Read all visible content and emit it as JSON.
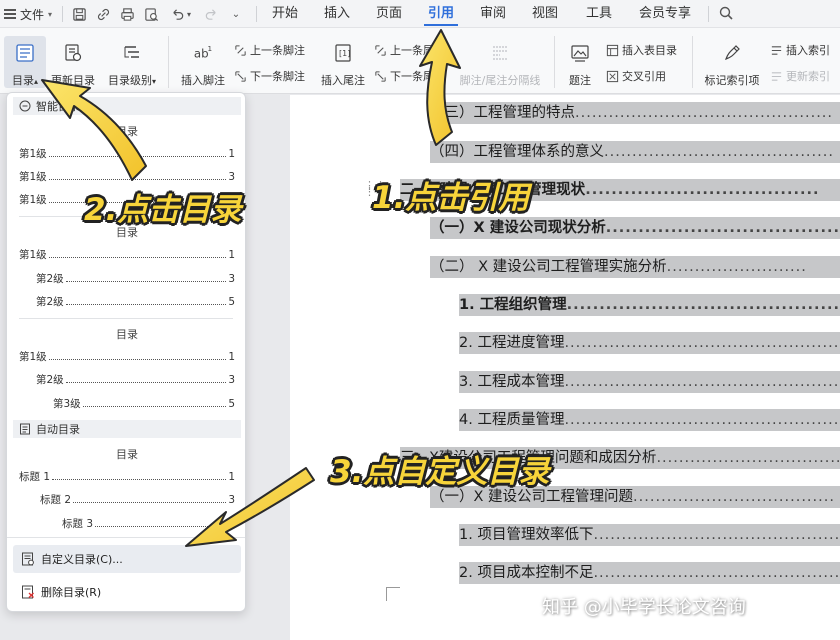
{
  "menubar": {
    "file_label": "文件",
    "tabs": [
      "开始",
      "插入",
      "页面",
      "引用",
      "审阅",
      "视图",
      "工具",
      "会员专享"
    ],
    "active_tab": "引用"
  },
  "ribbon": {
    "toc_label": "目录",
    "update_toc_label": "更新目录",
    "toc_level_label": "目录级别",
    "insert_footnote_label": "插入脚注",
    "prev_footnote_label": "上一条脚注",
    "next_footnote_label": "下一条脚注",
    "insert_endnote_label": "插入尾注",
    "prev_endnote_label": "上一条尾注",
    "next_endnote_label": "下一条尾注",
    "footnote_separator_label": "脚注/尾注分隔线",
    "caption_label": "题注",
    "insert_table_toc_label": "插入表目录",
    "cross_ref_label": "交叉引用",
    "mark_index_label": "标记索引项",
    "insert_index_label": "插入索引",
    "update_index_label": "更新索引"
  },
  "dropdown": {
    "smart_section": "智能目录",
    "auto_section": "自动目录",
    "toc_title": "目录",
    "level1": "第1级",
    "level2": "第2级",
    "level3": "第3级",
    "heading1": "标题 1",
    "heading2": "标题 2",
    "heading3": "标题 3",
    "page_1": "1",
    "page_3": "3",
    "page_5": "5",
    "custom_toc": "自定义目录(C)...",
    "delete_toc": "删除目录(R)"
  },
  "document": {
    "lines": [
      {
        "text": "（三）工程管理的特点",
        "dots": "..............................................",
        "bold": false
      },
      {
        "text": "（四）工程管理体系的意义",
        "dots": ".........................................",
        "bold": false
      },
      {
        "text": "二、X建设公司工程管理现状",
        "dots": "....................................",
        "bold": true
      },
      {
        "text": "（一）X 建设公司现状分析",
        "dots": "..........................................",
        "bold": true
      },
      {
        "text": "（二） X 建设公司工程管理实施分析",
        "dots": ".........................",
        "bold": false
      },
      {
        "text": "1. 工程组织管理",
        "dots": "..................................................",
        "bold": true
      },
      {
        "text": "2. 工程进度管理",
        "dots": "..................................................",
        "bold": false
      },
      {
        "text": "3. 工程成本管理",
        "dots": "..................................................",
        "bold": false
      },
      {
        "text": "4. 工程质量管理",
        "dots": "..................................................",
        "bold": false
      },
      {
        "text": "三、X建设公司工程管理问题和成因分析",
        "dots": ".................................",
        "bold": false
      },
      {
        "text": "（一）X 建设公司工程管理问题",
        "dots": "....................................",
        "bold": false
      },
      {
        "text": "1. 项目管理效率低下",
        "dots": ".............................................",
        "bold": false
      },
      {
        "text": "2. 项目成本控制不足",
        "dots": ".............................................",
        "bold": false
      }
    ]
  },
  "annotations": {
    "step1": "1.点击引用",
    "step2": "2.点击目录",
    "step3": "3.点自定义目录",
    "watermark": "知乎 @小毕学长论文咨询"
  },
  "colors": {
    "accent": "#2f6fdb",
    "annotation_yellow": "#f7d43a",
    "toc_highlight": "#c6c7c9"
  }
}
